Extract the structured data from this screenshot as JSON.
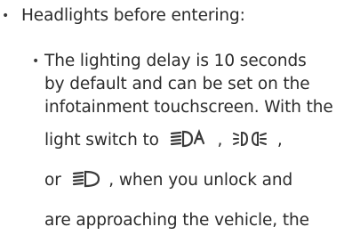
{
  "list": {
    "item1": {
      "bullet": "•",
      "text": "Headlights before entering:"
    },
    "item2": {
      "bullet": "•",
      "line1": "The lighting delay is 10 seconds",
      "line2": "by default and can be set on the",
      "line3": "infotainment touchscreen. With the",
      "line4_prefix": "light switch to",
      "sep1": ",",
      "sep2": ",",
      "line5_prefix": "or",
      "line5_suffix": ", when you unlock and",
      "line6": "are approaching the vehicle, the"
    }
  },
  "icons": {
    "auto_headlight": "auto-low-beam-headlight-icon",
    "parking_lights": "parking-lights-icon",
    "low_beam": "low-beam-headlight-icon"
  },
  "colors": {
    "text": "#2b2b2b",
    "icon": "#3a3a3a"
  }
}
